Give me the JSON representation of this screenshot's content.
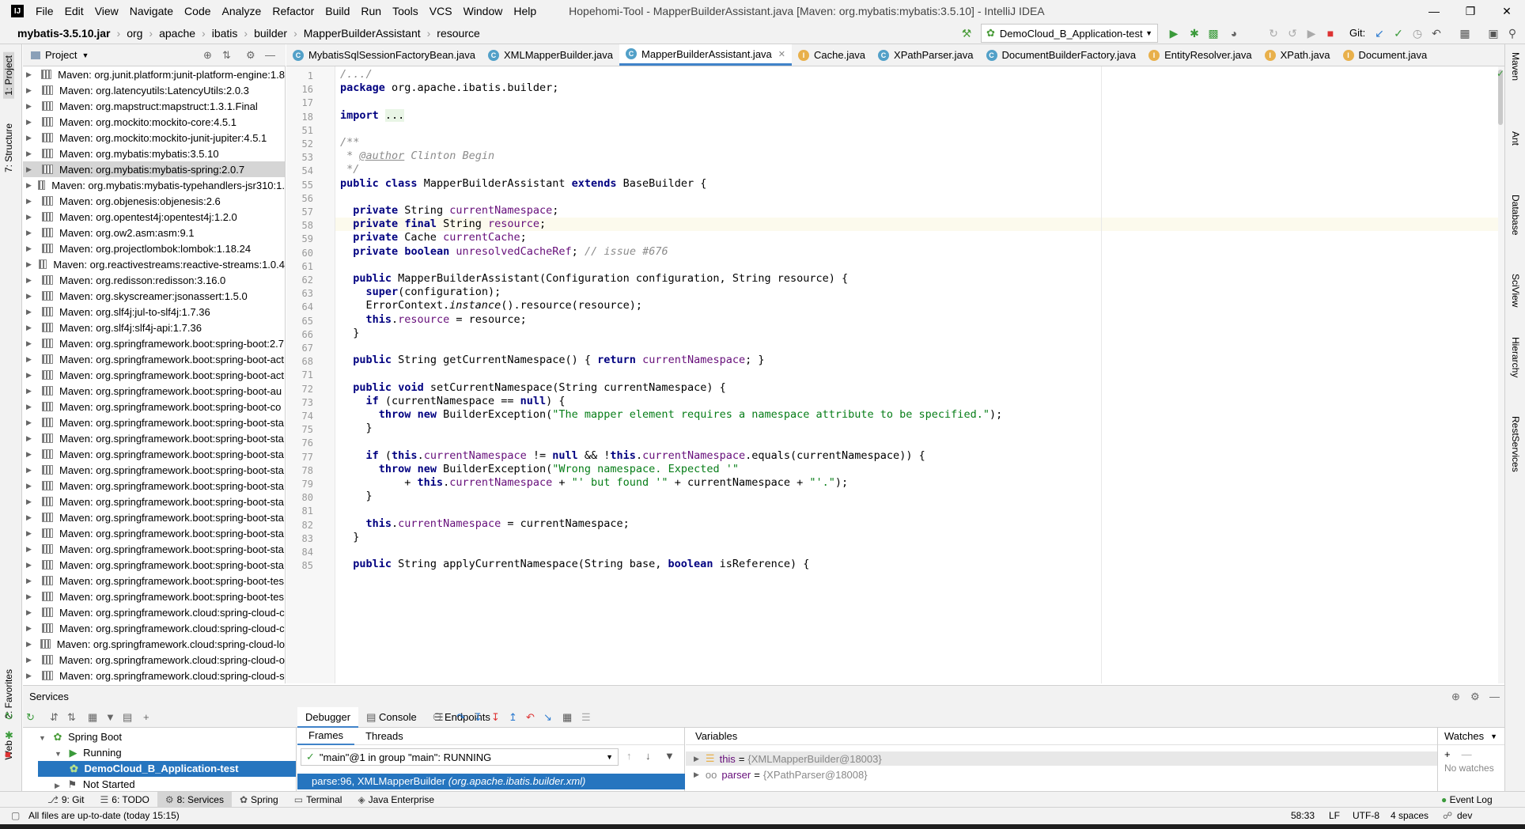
{
  "window": {
    "title": "Hopehomi-Tool - MapperBuilderAssistant.java [Maven: org.mybatis:mybatis:3.5.10] - IntelliJ IDEA",
    "logo_text": "IJ"
  },
  "menu": [
    "File",
    "Edit",
    "View",
    "Navigate",
    "Code",
    "Analyze",
    "Refactor",
    "Build",
    "Run",
    "Tools",
    "VCS",
    "Window",
    "Help"
  ],
  "breadcrumb": [
    "mybatis-3.5.10.jar",
    "org",
    "apache",
    "ibatis",
    "builder",
    "MapperBuilderAssistant",
    "resource"
  ],
  "run_config": "DemoCloud_B_Application-test",
  "git_label": "Git:",
  "left_stripe": {
    "project": "1: Project",
    "structure": "7: Structure",
    "favorites": "2: Favorites",
    "web": "Web"
  },
  "right_stripe": [
    "Maven",
    "Ant",
    "Database",
    "SciView",
    "Hierarchy",
    "RestServices"
  ],
  "project_panel": {
    "title": "Project",
    "items": [
      {
        "label": "Maven: org.junit.platform:junit-platform-engine:1.8",
        "selected": false
      },
      {
        "label": "Maven: org.latencyutils:LatencyUtils:2.0.3",
        "selected": false
      },
      {
        "label": "Maven: org.mapstruct:mapstruct:1.3.1.Final",
        "selected": false
      },
      {
        "label": "Maven: org.mockito:mockito-core:4.5.1",
        "selected": false
      },
      {
        "label": "Maven: org.mockito:mockito-junit-jupiter:4.5.1",
        "selected": false
      },
      {
        "label": "Maven: org.mybatis:mybatis:3.5.10",
        "selected": false
      },
      {
        "label": "Maven: org.mybatis:mybatis-spring:2.0.7",
        "selected": true
      },
      {
        "label": "Maven: org.mybatis:mybatis-typehandlers-jsr310:1.",
        "selected": false
      },
      {
        "label": "Maven: org.objenesis:objenesis:2.6",
        "selected": false
      },
      {
        "label": "Maven: org.opentest4j:opentest4j:1.2.0",
        "selected": false
      },
      {
        "label": "Maven: org.ow2.asm:asm:9.1",
        "selected": false
      },
      {
        "label": "Maven: org.projectlombok:lombok:1.18.24",
        "selected": false
      },
      {
        "label": "Maven: org.reactivestreams:reactive-streams:1.0.4",
        "selected": false
      },
      {
        "label": "Maven: org.redisson:redisson:3.16.0",
        "selected": false
      },
      {
        "label": "Maven: org.skyscreamer:jsonassert:1.5.0",
        "selected": false
      },
      {
        "label": "Maven: org.slf4j:jul-to-slf4j:1.7.36",
        "selected": false
      },
      {
        "label": "Maven: org.slf4j:slf4j-api:1.7.36",
        "selected": false
      },
      {
        "label": "Maven: org.springframework.boot:spring-boot:2.7",
        "selected": false
      },
      {
        "label": "Maven: org.springframework.boot:spring-boot-act",
        "selected": false
      },
      {
        "label": "Maven: org.springframework.boot:spring-boot-act",
        "selected": false
      },
      {
        "label": "Maven: org.springframework.boot:spring-boot-au",
        "selected": false
      },
      {
        "label": "Maven: org.springframework.boot:spring-boot-co",
        "selected": false
      },
      {
        "label": "Maven: org.springframework.boot:spring-boot-sta",
        "selected": false
      },
      {
        "label": "Maven: org.springframework.boot:spring-boot-sta",
        "selected": false
      },
      {
        "label": "Maven: org.springframework.boot:spring-boot-sta",
        "selected": false
      },
      {
        "label": "Maven: org.springframework.boot:spring-boot-sta",
        "selected": false
      },
      {
        "label": "Maven: org.springframework.boot:spring-boot-sta",
        "selected": false
      },
      {
        "label": "Maven: org.springframework.boot:spring-boot-sta",
        "selected": false
      },
      {
        "label": "Maven: org.springframework.boot:spring-boot-sta",
        "selected": false
      },
      {
        "label": "Maven: org.springframework.boot:spring-boot-sta",
        "selected": false
      },
      {
        "label": "Maven: org.springframework.boot:spring-boot-sta",
        "selected": false
      },
      {
        "label": "Maven: org.springframework.boot:spring-boot-sta",
        "selected": false
      },
      {
        "label": "Maven: org.springframework.boot:spring-boot-tes",
        "selected": false
      },
      {
        "label": "Maven: org.springframework.boot:spring-boot-tes",
        "selected": false
      },
      {
        "label": "Maven: org.springframework.cloud:spring-cloud-c",
        "selected": false
      },
      {
        "label": "Maven: org.springframework.cloud:spring-cloud-c",
        "selected": false
      },
      {
        "label": "Maven: org.springframework.cloud:spring-cloud-lo",
        "selected": false
      },
      {
        "label": "Maven: org.springframework.cloud:spring-cloud-o",
        "selected": false
      },
      {
        "label": "Maven: org.springframework.cloud:spring-cloud-s",
        "selected": false
      }
    ]
  },
  "tabs": [
    {
      "label": "MybatisSqlSessionFactoryBean.java",
      "icon": "c",
      "active": false
    },
    {
      "label": "XMLMapperBuilder.java",
      "icon": "c",
      "active": false
    },
    {
      "label": "MapperBuilderAssistant.java",
      "icon": "c",
      "active": true
    },
    {
      "label": "Cache.java",
      "icon": "i",
      "active": false
    },
    {
      "label": "XPathParser.java",
      "icon": "c",
      "active": false
    },
    {
      "label": "DocumentBuilderFactory.java",
      "icon": "c",
      "active": false
    },
    {
      "label": "EntityResolver.java",
      "icon": "i",
      "active": false
    },
    {
      "label": "XPath.java",
      "icon": "i",
      "active": false
    },
    {
      "label": "Document.java",
      "icon": "i",
      "active": false
    }
  ],
  "code": {
    "lines": [
      {
        "n": "1",
        "text": "/.../"
      },
      {
        "n": "16",
        "text": "package org.apache.ibatis.builder;"
      },
      {
        "n": "17",
        "text": ""
      },
      {
        "n": "18",
        "text": "import ..."
      },
      {
        "n": "51",
        "text": ""
      },
      {
        "n": "52",
        "text": "/**"
      },
      {
        "n": "53",
        "text": " * @author Clinton Begin"
      },
      {
        "n": "54",
        "text": " */"
      },
      {
        "n": "55",
        "text": "public class MapperBuilderAssistant extends BaseBuilder {"
      },
      {
        "n": "56",
        "text": ""
      },
      {
        "n": "57",
        "text": "  private String currentNamespace;"
      },
      {
        "n": "58",
        "text": "  private final String resource;"
      },
      {
        "n": "59",
        "text": "  private Cache currentCache;"
      },
      {
        "n": "60",
        "text": "  private boolean unresolvedCacheRef; // issue #676"
      },
      {
        "n": "61",
        "text": ""
      },
      {
        "n": "62",
        "text": "  public MapperBuilderAssistant(Configuration configuration, String resource) {"
      },
      {
        "n": "63",
        "text": "    super(configuration);"
      },
      {
        "n": "64",
        "text": "    ErrorContext.instance().resource(resource);"
      },
      {
        "n": "65",
        "text": "    this.resource = resource;"
      },
      {
        "n": "66",
        "text": "  }"
      },
      {
        "n": "67",
        "text": ""
      },
      {
        "n": "68",
        "text": "  public String getCurrentNamespace() { return currentNamespace; }"
      },
      {
        "n": "71",
        "text": ""
      },
      {
        "n": "72",
        "text": "  public void setCurrentNamespace(String currentNamespace) {"
      },
      {
        "n": "73",
        "text": "    if (currentNamespace == null) {"
      },
      {
        "n": "74",
        "text": "      throw new BuilderException(\"The mapper element requires a namespace attribute to be specified.\");"
      },
      {
        "n": "75",
        "text": "    }"
      },
      {
        "n": "76",
        "text": ""
      },
      {
        "n": "77",
        "text": "    if (this.currentNamespace != null && !this.currentNamespace.equals(currentNamespace)) {"
      },
      {
        "n": "78",
        "text": "      throw new BuilderException(\"Wrong namespace. Expected '\""
      },
      {
        "n": "79",
        "text": "          + this.currentNamespace + \"' but found '\" + currentNamespace + \"'.\");"
      },
      {
        "n": "80",
        "text": "    }"
      },
      {
        "n": "81",
        "text": ""
      },
      {
        "n": "82",
        "text": "    this.currentNamespace = currentNamespace;"
      },
      {
        "n": "83",
        "text": "  }"
      },
      {
        "n": "84",
        "text": ""
      },
      {
        "n": "85",
        "text": "  public String applyCurrentNamespace(String base, boolean isReference) {"
      }
    ]
  },
  "services": {
    "title": "Services",
    "tree": [
      {
        "label": "Spring Boot"
      },
      {
        "label": "Running"
      },
      {
        "label": "DemoCloud_B_Application-test"
      },
      {
        "label": "Not Started"
      }
    ],
    "debugger_tabs": [
      "Debugger",
      "Console",
      "Endpoints"
    ],
    "frames_tab": "Frames",
    "threads_tab": "Threads",
    "thread_select": "\"main\"@1 in group \"main\": RUNNING",
    "frame_row": "parse:96, XMLMapperBuilder",
    "frame_pkg": "(org.apache.ibatis.builder.xml)",
    "variables_title": "Variables",
    "vars": [
      {
        "name": "this",
        "value": "{XMLMapperBuilder@18003}"
      },
      {
        "name": "parser",
        "value": "{XPathParser@18008}"
      }
    ],
    "watches_title": "Watches",
    "no_watches": "No watches"
  },
  "bottom_tools": [
    "9: Git",
    "6: TODO",
    "8: Services",
    "Spring",
    "Terminal",
    "Java Enterprise"
  ],
  "event_log": "Event Log",
  "status": {
    "message": "All files are up-to-date (today 15:15)",
    "position": "58:33",
    "line_sep": "LF",
    "encoding": "UTF-8",
    "indent": "4 spaces",
    "branch": "dev"
  }
}
